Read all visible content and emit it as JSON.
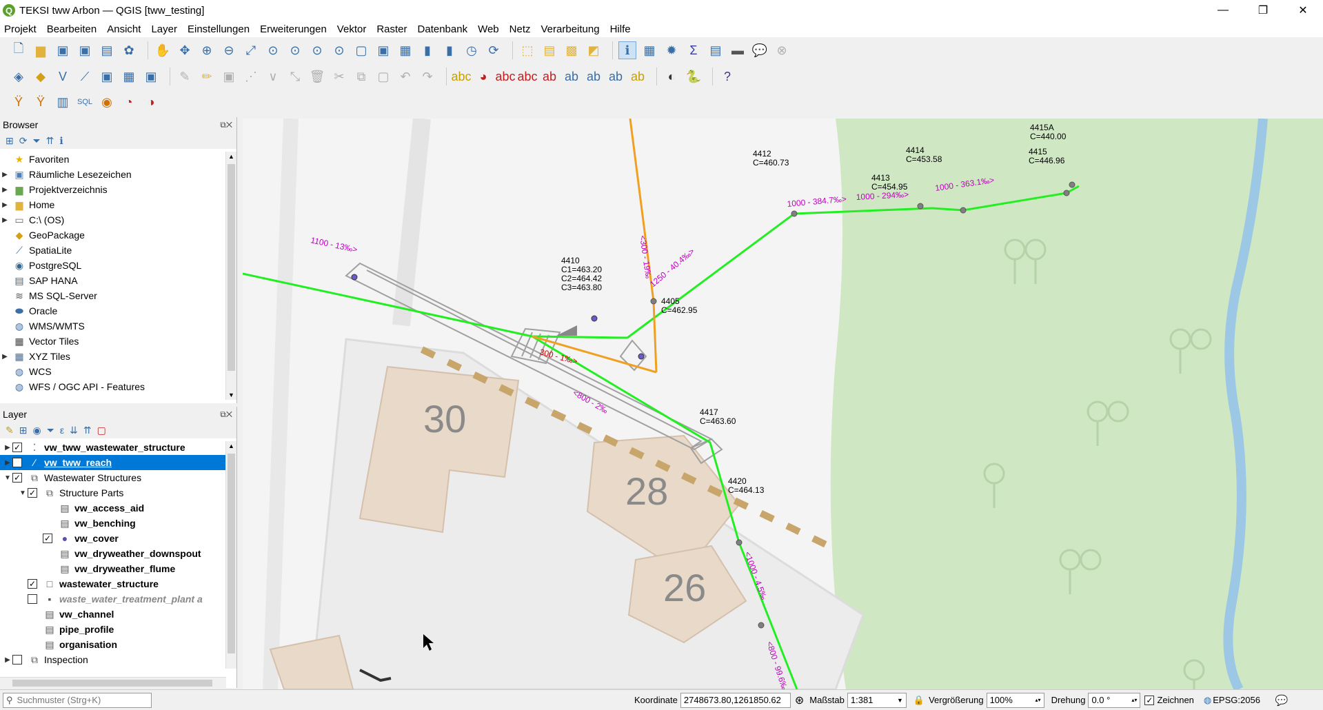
{
  "window": {
    "title": "TEKSI tww Arbon — QGIS [tww_testing]",
    "app_icon": "Q",
    "minimize": "—",
    "maximize": "❐",
    "close": "✕"
  },
  "menu": [
    "Projekt",
    "Bearbeiten",
    "Ansicht",
    "Layer",
    "Einstellungen",
    "Erweiterungen",
    "Vektor",
    "Raster",
    "Datenbank",
    "Web",
    "Netz",
    "Verarbeitung",
    "Hilfe"
  ],
  "browser": {
    "title": "Browser",
    "items": [
      {
        "label": "Favoriten",
        "icon": "star-icon",
        "glyph": "★",
        "color": "#e8b400",
        "arrow": ""
      },
      {
        "label": "Räumliche Lesezeichen",
        "icon": "bookmark-icon",
        "glyph": "▣",
        "color": "#4a7fc0",
        "arrow": "▶"
      },
      {
        "label": "Projektverzeichnis",
        "icon": "folder-icon",
        "glyph": "▆",
        "color": "#6aa84f",
        "arrow": "▶"
      },
      {
        "label": "Home",
        "icon": "home-folder-icon",
        "glyph": "▆",
        "color": "#e2b33c",
        "arrow": "▶"
      },
      {
        "label": "C:\\ (OS)",
        "icon": "drive-icon",
        "glyph": "▭",
        "color": "#666",
        "arrow": "▶"
      },
      {
        "label": "GeoPackage",
        "icon": "geopackage-icon",
        "glyph": "◆",
        "color": "#d4a017",
        "arrow": ""
      },
      {
        "label": "SpatiaLite",
        "icon": "spatialite-icon",
        "glyph": "⟋",
        "color": "#3a6ea5",
        "arrow": ""
      },
      {
        "label": "PostgreSQL",
        "icon": "postgresql-icon",
        "glyph": "◉",
        "color": "#336791",
        "arrow": ""
      },
      {
        "label": "SAP HANA",
        "icon": "sap-hana-icon",
        "glyph": "▤",
        "color": "#336791",
        "arrow": ""
      },
      {
        "label": "MS SQL-Server",
        "icon": "mssql-icon",
        "glyph": "≋",
        "color": "#555",
        "arrow": ""
      },
      {
        "label": "Oracle",
        "icon": "oracle-icon",
        "glyph": "⬬",
        "color": "#3a6ea5",
        "arrow": ""
      },
      {
        "label": "WMS/WMTS",
        "icon": "wms-icon",
        "glyph": "◍",
        "color": "#3a6ea5",
        "arrow": ""
      },
      {
        "label": "Vector Tiles",
        "icon": "vector-tiles-icon",
        "glyph": "▦",
        "color": "#444",
        "arrow": ""
      },
      {
        "label": "XYZ Tiles",
        "icon": "xyz-tiles-icon",
        "glyph": "▦",
        "color": "#3a6ea5",
        "arrow": "▶"
      },
      {
        "label": "WCS",
        "icon": "wcs-icon",
        "glyph": "◍",
        "color": "#3a6ea5",
        "arrow": ""
      },
      {
        "label": "WFS / OGC API - Features",
        "icon": "wfs-icon",
        "glyph": "◍",
        "color": "#3a6ea5",
        "arrow": ""
      }
    ]
  },
  "layers": {
    "title": "Layer",
    "items": [
      {
        "label": "vw_tww_wastewater_structure",
        "indent": 0,
        "arrow": "▶",
        "checked": true,
        "icon": "point-layer-icon",
        "glyph": "⁚",
        "style": "bold"
      },
      {
        "label": "vw_tww_reach",
        "indent": 0,
        "arrow": "▶",
        "checked": true,
        "icon": "line-layer-icon",
        "glyph": "∕",
        "style": "selected"
      },
      {
        "label": "Wastewater Structures",
        "indent": 0,
        "arrow": "▼",
        "checked": true,
        "icon": "group-icon",
        "glyph": "⧉",
        "style": ""
      },
      {
        "label": "Structure Parts",
        "indent": 1,
        "arrow": "▼",
        "checked": true,
        "icon": "group-icon",
        "glyph": "⧉",
        "style": ""
      },
      {
        "label": "vw_access_aid",
        "indent": 2,
        "arrow": "",
        "checked": null,
        "icon": "table-icon",
        "glyph": "▤",
        "style": "bold"
      },
      {
        "label": "vw_benching",
        "indent": 2,
        "arrow": "",
        "checked": null,
        "icon": "table-icon",
        "glyph": "▤",
        "style": "bold"
      },
      {
        "label": "vw_cover",
        "indent": 2,
        "arrow": "",
        "checked": true,
        "icon": "cover-point-icon",
        "glyph": "●",
        "style": "bold"
      },
      {
        "label": "vw_dryweather_downspout",
        "indent": 2,
        "arrow": "",
        "checked": null,
        "icon": "table-icon",
        "glyph": "▤",
        "style": "bold"
      },
      {
        "label": "vw_dryweather_flume",
        "indent": 2,
        "arrow": "",
        "checked": null,
        "icon": "table-icon",
        "glyph": "▤",
        "style": "bold"
      },
      {
        "label": "wastewater_structure",
        "indent": 1,
        "arrow": "",
        "checked": true,
        "icon": "polygon-icon",
        "glyph": "□",
        "style": "bold"
      },
      {
        "label": "waste_water_treatment_plant a",
        "indent": 1,
        "arrow": "",
        "checked": false,
        "icon": "polygon-icon",
        "glyph": "▪",
        "style": "italic"
      },
      {
        "label": "vw_channel",
        "indent": 1,
        "arrow": "",
        "checked": null,
        "icon": "table-icon",
        "glyph": "▤",
        "style": "bold"
      },
      {
        "label": "pipe_profile",
        "indent": 1,
        "arrow": "",
        "checked": null,
        "icon": "table-icon",
        "glyph": "▤",
        "style": "bold"
      },
      {
        "label": "organisation",
        "indent": 1,
        "arrow": "",
        "checked": null,
        "icon": "table-icon",
        "glyph": "▤",
        "style": "bold"
      },
      {
        "label": "Inspection",
        "indent": 0,
        "arrow": "▶",
        "checked": false,
        "icon": "group-icon",
        "glyph": "⧉",
        "style": ""
      }
    ]
  },
  "map": {
    "house_numbers": [
      "30",
      "28",
      "26"
    ],
    "nodes": [
      {
        "id": "4410",
        "lines": [
          "4410",
          "C1=463.20",
          "C2=464.42",
          "C3=463.80"
        ]
      },
      {
        "id": "4405",
        "lines": [
          "4405",
          "C=462.95"
        ]
      },
      {
        "id": "4412",
        "lines": [
          "4412",
          "C=460.73"
        ]
      },
      {
        "id": "4413",
        "lines": [
          "4413",
          "C=454.95"
        ]
      },
      {
        "id": "4414",
        "lines": [
          "4414",
          "C=453.58"
        ]
      },
      {
        "id": "4415",
        "lines": [
          "4415",
          "C=446.96"
        ]
      },
      {
        "id": "4415A",
        "lines": [
          "4415A",
          "C=440.00"
        ]
      },
      {
        "id": "4417",
        "lines": [
          "4417",
          "C=463.60"
        ]
      },
      {
        "id": "4420",
        "lines": [
          "4420",
          "C=464.13"
        ]
      }
    ],
    "reach_labels": {
      "r1100": "1100 - 13‰>",
      "r300": "300 - 1‰>",
      "r800a": "<800 - 2‰",
      "r300b": "<300 - 19‰",
      "r1250": "1250 - 40.4‰>",
      "r1000a": "1000 - 384.7‰>",
      "r1000b": "1000 - 294‰>",
      "r1000c": "1000 - 363.1‰>",
      "r1000d": "<1000 - 4.5‰",
      "r800b": "<800 - 99.6‰"
    },
    "colors": {
      "reach_green": "#22ee22",
      "reach_orange": "#f0a020",
      "label_magenta": "#c000c0",
      "forest": "#cfe8c3",
      "river": "#9cc8e6"
    }
  },
  "status": {
    "search_placeholder": "Suchmuster (Strg+K)",
    "coord_label": "Koordinate",
    "coord_value": "2748673.80,1261850.62",
    "scale_label": "Maßstab",
    "scale_value": "1:381",
    "zoom_label": "Vergrößerung",
    "zoom_value": "100%",
    "rotation_label": "Drehung",
    "rotation_value": "0.0 °",
    "render_label": "Zeichnen",
    "crs": "EPSG:2056"
  }
}
